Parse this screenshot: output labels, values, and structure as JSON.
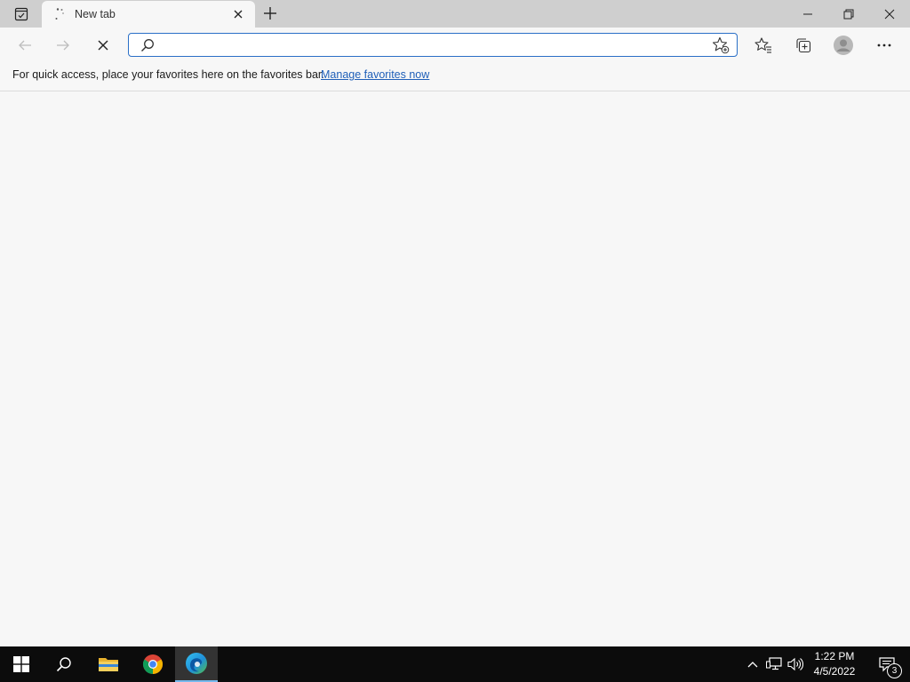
{
  "browser": {
    "tab": {
      "title": "New tab"
    },
    "address_bar": {
      "value": "",
      "placeholder": ""
    },
    "favorites_bar": {
      "message": "For quick access, place your favorites here on the favorites bar.",
      "link": "Manage favorites now"
    },
    "toolbar_icons": [
      "back-arrow-icon",
      "forward-arrow-icon",
      "stop-icon",
      "search-icon",
      "add-favorite-icon",
      "favorites-icon",
      "collections-icon",
      "profile-icon",
      "more-icon"
    ],
    "colors": {
      "accent": "#2a6fc7",
      "link": "#1f5fb8",
      "chrome": "#cfcfcf",
      "page": "#f7f7f7"
    }
  },
  "taskbar": {
    "apps": [
      "windows-start",
      "search",
      "file-explorer",
      "chrome",
      "edge"
    ],
    "active_app": "edge",
    "clock": {
      "time": "1:22 PM",
      "date": "4/5/2022"
    },
    "notifications_count": "3",
    "colors": {
      "background": "#0c0c0c",
      "active_indicator": "#76b9ed"
    }
  }
}
